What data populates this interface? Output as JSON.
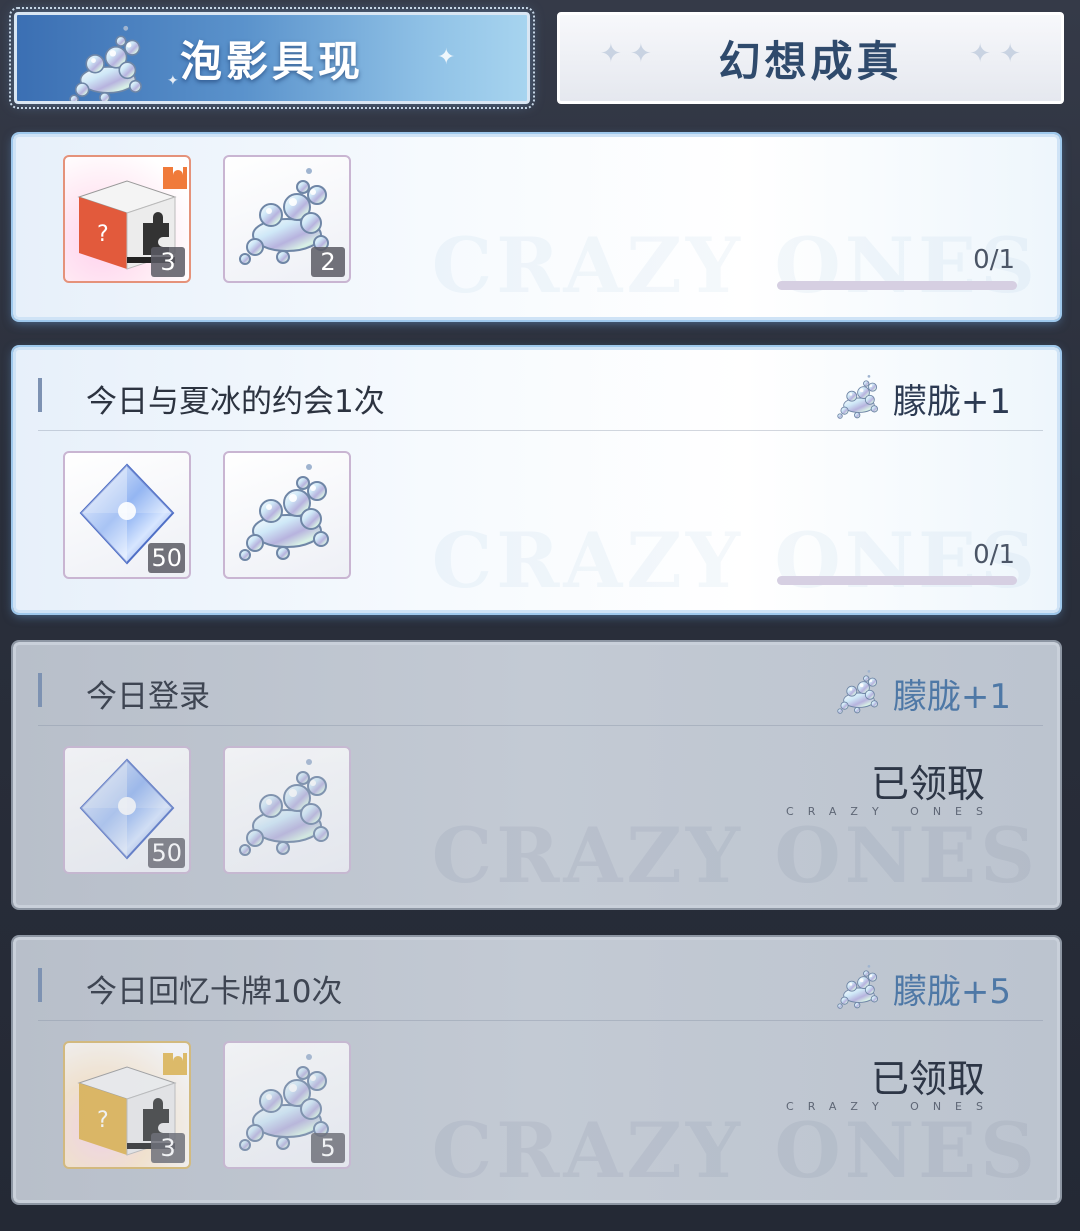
{
  "tabs": [
    {
      "label": "泡影具现",
      "active": true
    },
    {
      "label": "幻想成真",
      "active": false
    }
  ],
  "watermark_text": "CRAZY ONES",
  "tasks": [
    {
      "title": "",
      "status": "in_progress",
      "rewards": [
        {
          "icon": "red-puzzle-box-icon",
          "count": "3"
        },
        {
          "icon": "bubble-icon",
          "count": "2"
        }
      ],
      "progress_text": "0/1",
      "progress_fraction": 0
    },
    {
      "title": "今日与夏冰的约会1次",
      "status": "in_progress",
      "reward_label": "朦胧+1",
      "rewards": [
        {
          "icon": "crystal-icon",
          "count": "50"
        },
        {
          "icon": "bubble-icon",
          "count": ""
        }
      ],
      "progress_text": "0/1",
      "progress_fraction": 0
    },
    {
      "title": "今日登录",
      "status": "claimed",
      "reward_label": "朦胧+1",
      "rewards": [
        {
          "icon": "crystal-icon",
          "count": "50"
        },
        {
          "icon": "bubble-icon",
          "count": ""
        }
      ],
      "claimed_label": "已领取",
      "claimed_sub": "CRAZY ONES"
    },
    {
      "title": "今日回忆卡牌10次",
      "status": "claimed",
      "reward_label": "朦胧+5",
      "rewards": [
        {
          "icon": "gold-puzzle-box-icon",
          "count": "3"
        },
        {
          "icon": "bubble-icon",
          "count": "5"
        }
      ],
      "claimed_label": "已领取",
      "claimed_sub": "CRAZY ONES"
    }
  ]
}
